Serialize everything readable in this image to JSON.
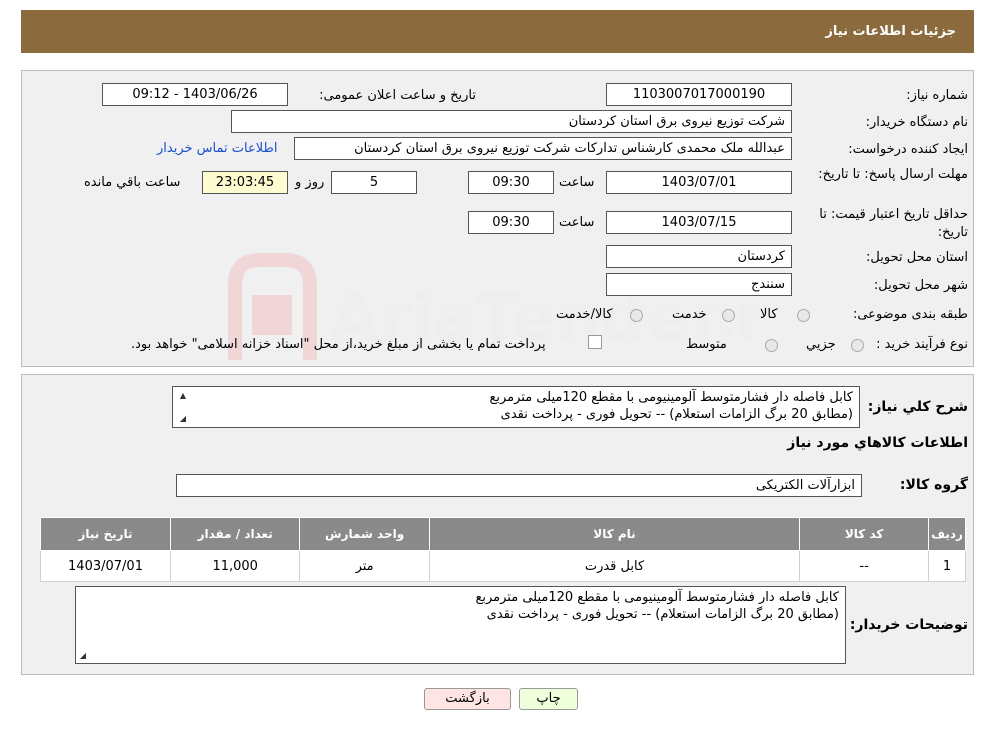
{
  "header": {
    "title": "جزئیات اطلاعات نیاز"
  },
  "watermark": {
    "text": "AriaTender.neT"
  },
  "fields": {
    "need_number_label": "شماره نیاز:",
    "need_number": "1103007017000190",
    "announce_datetime_label": "تاریخ و ساعت اعلان عمومی:",
    "announce_datetime": "1403/06/26 - 09:12",
    "buyer_org_label": "نام دستگاه خریدار:",
    "buyer_org": "شرکت توزیع نیروی برق استان کردستان",
    "requester_label": "ایجاد کننده درخواست:",
    "requester": "عبدالله ملک محمدی کارشناس تدارکات شرکت توزیع نیروی برق استان کردستان",
    "contact_link": "اطلاعات تماس خریدار",
    "deadline_label": "مهلت ارسال پاسخ: تا تاریخ:",
    "deadline_date": "1403/07/01",
    "time_label": "ساعت",
    "deadline_time": "09:30",
    "days_value": "5",
    "days_label": "روز و",
    "remaining_time": "23:03:45",
    "remaining_label": "ساعت باقي مانده",
    "validity_label": "حداقل تاریخ اعتبار قیمت: تا تاریخ:",
    "validity_date": "1403/07/15",
    "validity_time": "09:30",
    "province_label": "استان محل تحویل:",
    "province": "کردستان",
    "city_label": "شهر محل تحویل:",
    "city": "سنندج",
    "category_label": "طبقه بندی موضوعی:",
    "category_options": [
      "کالا",
      "خدمت",
      "کالا/خدمت"
    ],
    "purchase_type_label": "نوع فرآیند خرید :",
    "purchase_options": [
      "جزیي",
      "متوسط"
    ],
    "purchase_note": "پرداخت تمام یا بخشی از مبلغ خرید،از محل \"اسناد خزانه اسلامی\" خواهد بود."
  },
  "description": {
    "label": "شرح کلي نیاز:",
    "line1": "کابل فاصله دار فشارمتوسط آلومینیومی با مقطع 120میلی مترمربع",
    "line2": "(مطابق 20 برگ الزامات استعلام) -- تحویل فوری - پرداخت نقدی"
  },
  "items_section": {
    "title": "اطلاعات کالاهاي مورد نیاز",
    "group_label": "گروه کالا:",
    "group_value": "ابزارآلات الکتریکی"
  },
  "table": {
    "headers": [
      "ردیف",
      "کد کالا",
      "نام کالا",
      "واحد شمارش",
      "تعداد / مقدار",
      "تاریخ نیاز"
    ],
    "rows": [
      [
        "1",
        "--",
        "کابل قدرت",
        "متر",
        "11,000",
        "1403/07/01"
      ]
    ]
  },
  "buyer_notes": {
    "label": "توضیحات خریدار:",
    "line1": "کابل فاصله دار فشارمتوسط آلومینیومی با مقطع 120میلی مترمربع",
    "line2": "(مطابق 20 برگ الزامات استعلام) -- تحویل فوری - پرداخت نقدی"
  },
  "buttons": {
    "print": "چاپ",
    "back": "بازگشت"
  }
}
